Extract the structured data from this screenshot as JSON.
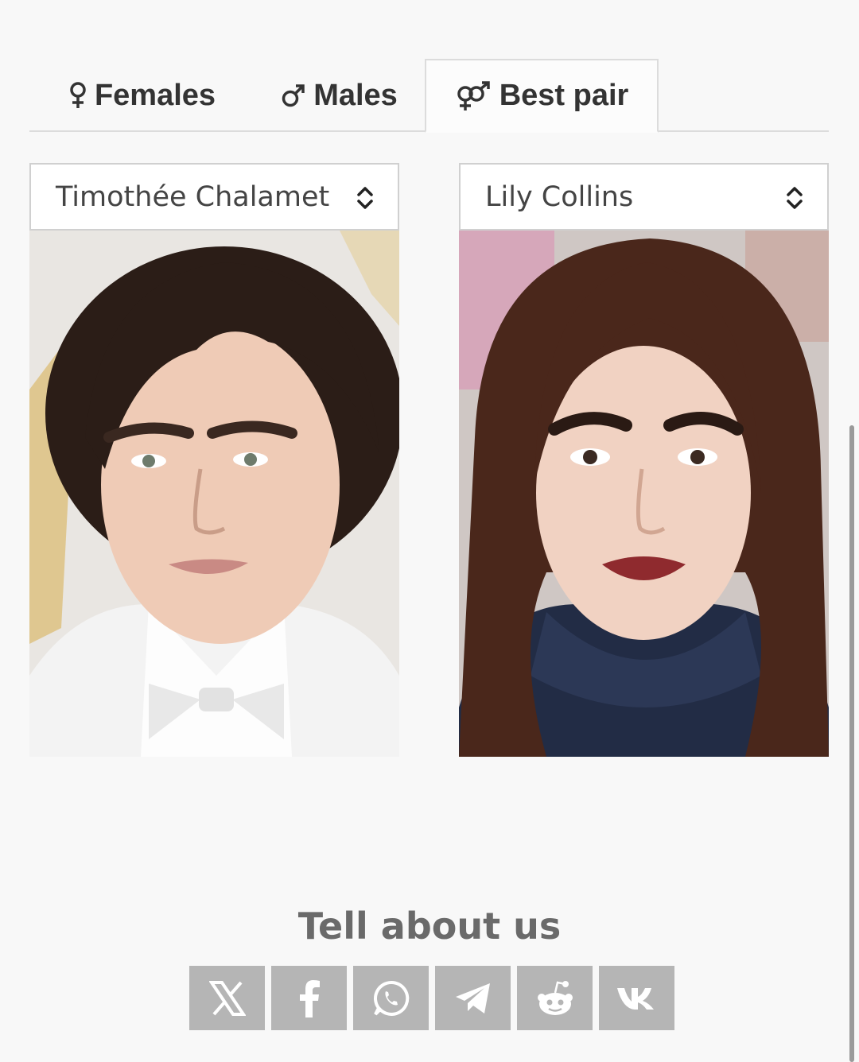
{
  "tabs": {
    "females": {
      "label": "Females",
      "icon": "female-icon"
    },
    "males": {
      "label": "Males",
      "icon": "male-icon"
    },
    "best_pair": {
      "label": "Best pair",
      "icon": "couple-icon",
      "active": true
    }
  },
  "pair": {
    "left": {
      "selected": "Timothée Chalamet",
      "photo": "portrait-photo"
    },
    "right": {
      "selected": "Lily Collins",
      "photo": "portrait-photo"
    }
  },
  "share": {
    "title": "Tell about us",
    "buttons": [
      {
        "name": "x-share-button",
        "icon": "x-icon"
      },
      {
        "name": "facebook-share-button",
        "icon": "facebook-icon"
      },
      {
        "name": "whatsapp-share-button",
        "icon": "whatsapp-icon"
      },
      {
        "name": "telegram-share-button",
        "icon": "telegram-icon"
      },
      {
        "name": "reddit-share-button",
        "icon": "reddit-icon"
      },
      {
        "name": "vk-share-button",
        "icon": "vk-icon"
      }
    ]
  },
  "colors": {
    "background": "#f8f8f8",
    "share_button": "#b5b5b5",
    "tab_text": "#333333",
    "share_title": "#6a6a6a"
  }
}
